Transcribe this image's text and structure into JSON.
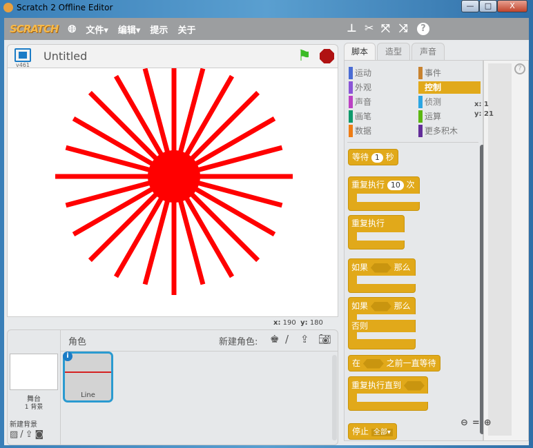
{
  "window": {
    "title": "Scratch 2 Offline Editor",
    "min": "—",
    "max": "□",
    "close": "X"
  },
  "menu": {
    "logo": "SCRATCH",
    "file": "文件▾",
    "edit": "编辑▾",
    "tips": "提示",
    "about": "关于",
    "help": "?"
  },
  "stage": {
    "project_title": "Untitled",
    "version": "v461",
    "x_label": "x:",
    "x": "190",
    "y_label": "y:",
    "y": "180"
  },
  "sprites": {
    "header": "角色",
    "new_sprite": "新建角色:",
    "stage_label": "舞台",
    "backdrops": "1 背景",
    "new_backdrop": "新建背景",
    "sprite_name": "Line"
  },
  "tabs": [
    "脚本",
    "造型",
    "声音"
  ],
  "categories": [
    {
      "label": "运动",
      "color": "#4a6cd4"
    },
    {
      "label": "事件",
      "color": "#c88330"
    },
    {
      "label": "外观",
      "color": "#8a55d7"
    },
    {
      "label": "控制",
      "color": "#e1a91a"
    },
    {
      "label": "声音",
      "color": "#bb42c3"
    },
    {
      "label": "侦测",
      "color": "#2ca5e2"
    },
    {
      "label": "画笔",
      "color": "#0e9a6c"
    },
    {
      "label": "运算",
      "color": "#5cb712"
    },
    {
      "label": "数据",
      "color": "#ee7d16"
    },
    {
      "label": "更多积木",
      "color": "#632d99"
    }
  ],
  "blocks": {
    "wait": "等待",
    "wait_val": "1",
    "sec": "秒",
    "repeat": "重复执行",
    "repeat_val": "10",
    "times": "次",
    "forever": "重复执行",
    "if": "如果",
    "then": "那么",
    "else": "否则",
    "wait_until_a": "在",
    "wait_until_b": "之前一直等待",
    "repeat_until": "重复执行直到",
    "stop": "停止",
    "stop_val": "全部▾"
  },
  "scripts": {
    "x_label": "x: 1",
    "y_label": "y: 21"
  }
}
